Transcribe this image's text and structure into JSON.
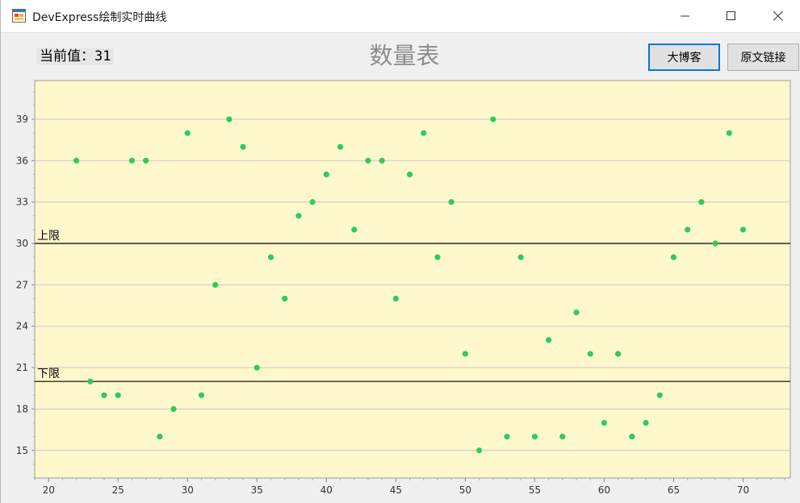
{
  "window": {
    "title": "DevExpress绘制实时曲线",
    "icon": "app-form-icon",
    "controls": [
      "minimize-icon",
      "maximize-icon",
      "close-icon"
    ]
  },
  "header": {
    "current_value_text": "当前值：31",
    "chart_title": "数量表",
    "buttons": {
      "blog": "大博客",
      "link": "原文链接"
    }
  },
  "colors": {
    "plot_background": "#fff8cc",
    "point": "#2ecc5a",
    "gridline": "#c8c8c8",
    "constant_line": "#000000",
    "blog_button_border": "#0078d7"
  },
  "chart_data": {
    "type": "scatter",
    "title": "数量表",
    "xlim": [
      19,
      73.4
    ],
    "ylim": [
      13,
      41.8
    ],
    "x_ticks": [
      20,
      25,
      30,
      35,
      40,
      45,
      50,
      55,
      60,
      65,
      70
    ],
    "y_ticks": [
      15,
      18,
      21,
      24,
      27,
      30,
      33,
      36,
      39
    ],
    "grid": "horizontal",
    "constant_lines": [
      {
        "label": "上限",
        "value": 30
      },
      {
        "label": "下限",
        "value": 20
      }
    ],
    "points": [
      [
        22,
        36
      ],
      [
        23,
        20
      ],
      [
        24,
        19
      ],
      [
        25,
        19
      ],
      [
        26,
        36
      ],
      [
        27,
        36
      ],
      [
        28,
        16
      ],
      [
        29,
        18
      ],
      [
        30,
        38
      ],
      [
        31,
        19
      ],
      [
        32,
        27
      ],
      [
        33,
        39
      ],
      [
        34,
        37
      ],
      [
        35,
        21
      ],
      [
        36,
        29
      ],
      [
        37,
        26
      ],
      [
        38,
        32
      ],
      [
        39,
        33
      ],
      [
        40,
        35
      ],
      [
        41,
        37
      ],
      [
        42,
        31
      ],
      [
        43,
        36
      ],
      [
        44,
        36
      ],
      [
        45,
        26
      ],
      [
        46,
        35
      ],
      [
        47,
        38
      ],
      [
        48,
        29
      ],
      [
        49,
        33
      ],
      [
        50,
        22
      ],
      [
        51,
        15
      ],
      [
        52,
        39
      ],
      [
        53,
        16
      ],
      [
        54,
        29
      ],
      [
        55,
        16
      ],
      [
        56,
        23
      ],
      [
        57,
        16
      ],
      [
        58,
        25
      ],
      [
        59,
        22
      ],
      [
        60,
        17
      ],
      [
        61,
        22
      ],
      [
        62,
        16
      ],
      [
        63,
        17
      ],
      [
        64,
        19
      ],
      [
        65,
        29
      ],
      [
        66,
        31
      ],
      [
        67,
        33
      ],
      [
        68,
        30
      ],
      [
        69,
        38
      ],
      [
        70,
        31
      ]
    ]
  }
}
